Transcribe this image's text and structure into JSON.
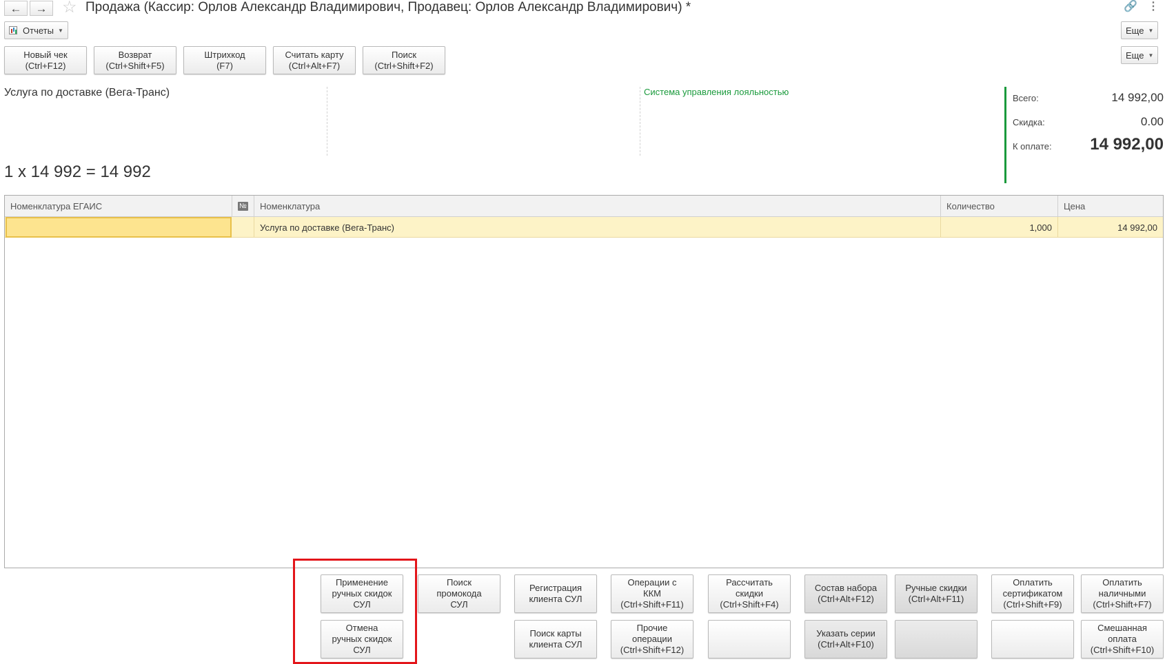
{
  "window": {
    "title": "Продажа (Кассир: Орлов Александр Владимирович, Продавец: Орлов Александр Владимирович) *",
    "icons": [
      "back-arrow-icon",
      "forward-arrow-icon",
      "favorite-star-icon",
      "link-icon",
      "more-vertical-icon"
    ]
  },
  "toolbar": {
    "reports_label": "Отчеты",
    "more_label": "Еще"
  },
  "commands": [
    {
      "line1": "Новый чек",
      "line2": "(Ctrl+F12)"
    },
    {
      "line1": "Возврат",
      "line2": "(Ctrl+Shift+F5)"
    },
    {
      "line1": "Штрихкод",
      "line2": "(F7)"
    },
    {
      "line1": "Считать карту",
      "line2": "(Ctrl+Alt+F7)"
    },
    {
      "line1": "Поиск",
      "line2": "(Ctrl+Shift+F2)"
    }
  ],
  "commands_more_label": "Еще",
  "info": {
    "current_item": "Услуга по доставке (Вега-Транс)",
    "loyalty_system": "Система управления лояльностью",
    "calculation": "1 x 14 992 = 14 992"
  },
  "totals": {
    "total_label": "Всего:",
    "total_value": "14 992,00",
    "discount_label": "Скидка:",
    "discount_value": "0.00",
    "to_pay_label": "К оплате:",
    "to_pay_value": "14 992,00",
    "accent_color": "#1a9a3c"
  },
  "table": {
    "columns": {
      "egais": "Номенклатура ЕГАИС",
      "num": "№",
      "nomenclature": "Номенклатура",
      "quantity": "Количество",
      "price": "Цена"
    },
    "rows": [
      {
        "egais": "",
        "num": "",
        "nomenclature": "Услуга по доставке (Вега-Транс)",
        "quantity": "1,000",
        "price": "14 992,00"
      }
    ]
  },
  "bottom_buttons": {
    "apply_manual": [
      "Применение",
      "ручных скидок",
      "СУЛ"
    ],
    "cancel_manual": [
      "Отмена",
      "ручных скидок",
      "СУЛ"
    ],
    "promo_search": [
      "Поиск",
      "промокода",
      "СУЛ"
    ],
    "client_registration": [
      "Регистрация",
      "клиента СУЛ"
    ],
    "card_search": [
      "Поиск карты",
      "клиента СУЛ"
    ],
    "kkm_operations": [
      "Операции с",
      "ККМ",
      "(Ctrl+Shift+F11)"
    ],
    "other_operations": [
      "Прочие",
      "операции",
      "(Ctrl+Shift+F12)"
    ],
    "calc_discounts": [
      "Рассчитать",
      "скидки",
      "(Ctrl+Shift+F4)"
    ],
    "kit_composition": [
      "Состав набора",
      "(Ctrl+Alt+F12)"
    ],
    "specify_series": [
      "Указать серии",
      "(Ctrl+Alt+F10)"
    ],
    "manual_discounts": [
      "Ручные скидки",
      "(Ctrl+Alt+F11)"
    ],
    "pay_certificate": [
      "Оплатить",
      "сертификатом",
      "(Ctrl+Shift+F9)"
    ],
    "pay_cash": [
      "Оплатить",
      "наличными",
      "(Ctrl+Shift+F7)"
    ],
    "mixed_payment": [
      "Смешанная",
      "оплата",
      "(Ctrl+Shift+F10)"
    ]
  },
  "highlight_color": "#e3151a"
}
